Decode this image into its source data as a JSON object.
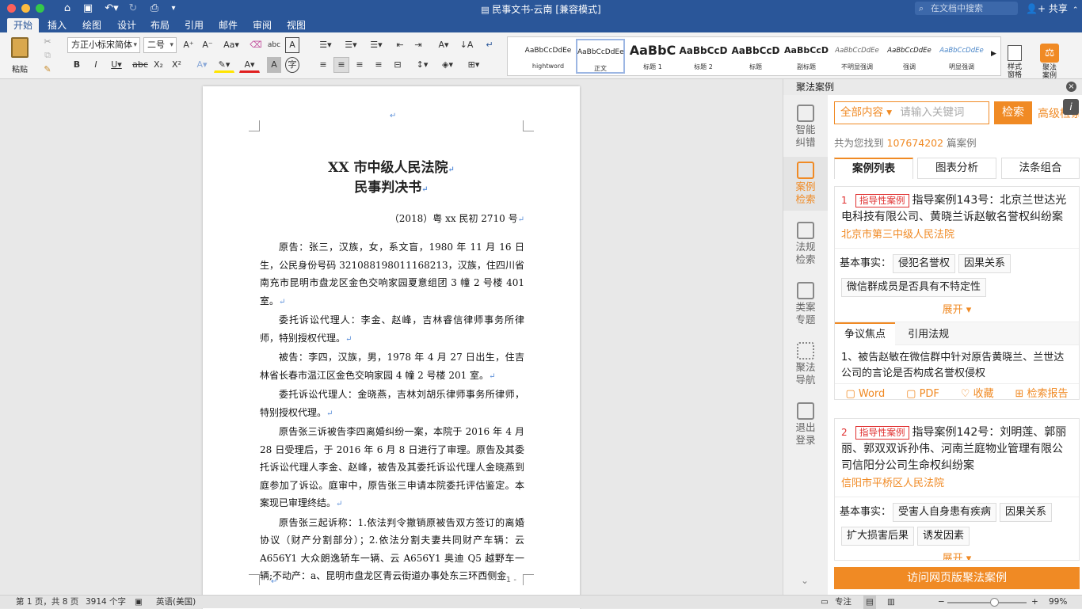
{
  "titlebar": {
    "title": "民事文书-云南 [兼容模式]",
    "search_placeholder": "在文档中搜索",
    "share": "共享"
  },
  "tabs": [
    "开始",
    "插入",
    "绘图",
    "设计",
    "布局",
    "引用",
    "邮件",
    "审阅",
    "视图"
  ],
  "ribbon": {
    "paste": "粘贴",
    "font_name": "方正小标宋简体",
    "font_size": "二号",
    "styles_pane": "样式\n窗格",
    "jufa_btn": "聚法\n案例"
  },
  "styles": [
    {
      "preview": "AaBbCcDdEe",
      "name": "hightword"
    },
    {
      "preview": "AaBbCcDdEe",
      "name": "正文"
    },
    {
      "preview": "AaBbC",
      "name": "标题 1"
    },
    {
      "preview": "AaBbCcD",
      "name": "标题 2"
    },
    {
      "preview": "AaBbCcD",
      "name": "标题"
    },
    {
      "preview": "AaBbCcD",
      "name": "副标题"
    },
    {
      "preview": "AaBbCcDdEe",
      "name": "不明显强调"
    },
    {
      "preview": "AaBbCcDdEe",
      "name": "强调"
    },
    {
      "preview": "AaBbCcDdEe",
      "name": "明显强调"
    }
  ],
  "doc": {
    "title1": "XX 市中级人民法院",
    "title2": "民事判决书",
    "case_no": "（2018）粤 xx 民初 2710 号",
    "paragraphs": [
      "原告：张三，汉族，女，系文盲，1980 年 11 月 16 日生，公民身份号码 321088198011168213，汉族，住四川省南充市昆明市盘龙区金色交响家园夏意组团 3 幢 2 号楼 401 室。",
      "委托诉讼代理人：李金、赵峰，吉林睿信律师事务所律师，特别授权代理。",
      "被告：李四，汉族，男，1978 年 4 月 27 日出生，住吉林省长春市温江区金色交响家园 4 幢 2 号楼 201 室。",
      "委托诉讼代理人：金晓燕，吉林刘胡乐律师事务所律师，特别授权代理。",
      "原告张三诉被告李四离婚纠纷一案，本院于 2016 年 4 月 28 日受理后，于 2016 年 6 月 8 日进行了审理。原告及其委托诉讼代理人李金、赵峰，被告及其委托诉讼代理人金晓燕到庭参加了诉讼。庭审中，原告张三申请本院委托评估鉴定。本案现已审理终结。",
      "原告张三起诉称：1.依法判令撤销原被告双方签订的离婚协议（财产分割部分）；2.依法分割夫妻共同财产车辆：云 A656Y1 大众朗逸轿车一辆、云 A656Y1 奥迪 Q5 越野车一辆;不动产：a、昆明市盘龙区青云街道办事处东三环西侧金"
    ],
    "page_footer": "- 1 -"
  },
  "panel": {
    "title": "聚法案例",
    "side": [
      {
        "l1": "智能",
        "l2": "纠错"
      },
      {
        "l1": "案例",
        "l2": "检索"
      },
      {
        "l1": "法规",
        "l2": "检索"
      },
      {
        "l1": "类案",
        "l2": "专题"
      },
      {
        "l1": "聚法",
        "l2": "导航"
      },
      {
        "l1": "退出",
        "l2": "登录"
      }
    ],
    "scope": "全部内容",
    "search_placeholder": "请输入关键词",
    "search_btn": "检索",
    "advanced": "高级检索",
    "found_prefix": "共为您找到",
    "found_count": "107674202",
    "found_suffix": "篇案例",
    "tabs": [
      "案例列表",
      "图表分析",
      "法条组合"
    ],
    "cases": [
      {
        "num": "1",
        "tag": "指导性案例",
        "title": "指导案例143号：北京兰世达光电科技有限公司、黄晓兰诉赵敏名誉权纠纷案",
        "court": "北京市第三中级人民法院",
        "facts_label": "基本事实：",
        "facts": [
          "侵犯名誉权",
          "因果关系",
          "微信群成员是否具有不特定性"
        ],
        "expand": "展开"
      },
      {
        "num": "2",
        "tag": "指导性案例",
        "title": "指导案例142号：刘明莲、郭丽丽、郭双双诉孙伟、河南兰庭物业管理有限公司信阳分公司生命权纠纷案",
        "court": "信阳市平桥区人民法院",
        "facts_label": "基本事实：",
        "facts": [
          "受害人自身患有疾病",
          "因果关系",
          "扩大损害后果",
          "诱发因素"
        ],
        "expand": "展开"
      }
    ],
    "subtabs": [
      "争议焦点",
      "引用法规"
    ],
    "dispute": "1、被告赵敏在微信群中针对原告黄晓兰、兰世达公司的言论是否构成名誉权侵权",
    "actions": [
      "Word",
      "PDF",
      "收藏",
      "检索报告"
    ],
    "visit_btn": "访问网页版聚法案例"
  },
  "status": {
    "page": "第 1 页，共 8 页",
    "words": "3914 个字",
    "lang": "英语(美国)",
    "focus": "专注",
    "zoom": "99%"
  }
}
